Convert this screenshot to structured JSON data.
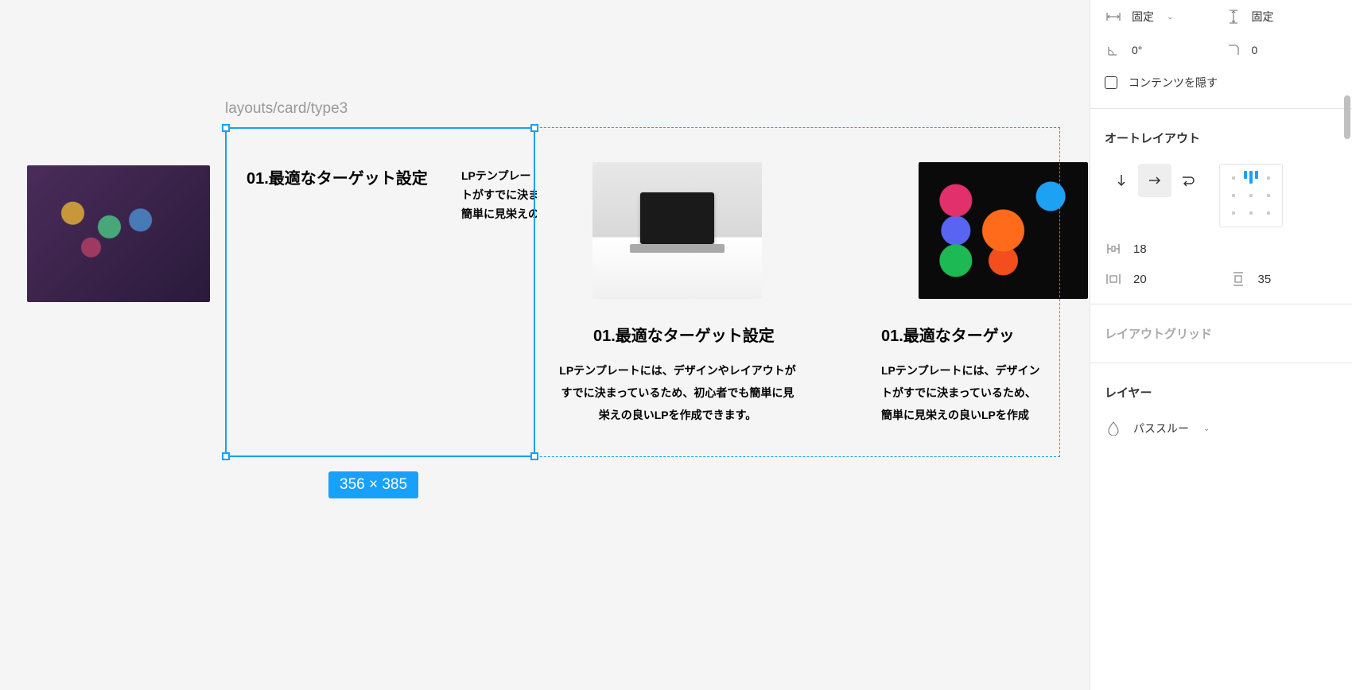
{
  "canvas": {
    "layer_label": "layouts/card/type3",
    "selection_size": "356 × 385",
    "cards": [
      {
        "title": "01.最適なターゲット設定",
        "desc_l1": "LPテンプレー",
        "desc_l2": "トがすでに決ま",
        "desc_l3": "簡単に見栄えの"
      },
      {
        "title": "01.最適なターゲット設定",
        "desc": "LPテンプレートには、デザインやレイアウトがすでに決まっているため、初心者でも簡単に見栄えの良いLPを作成できます。"
      },
      {
        "title": "01.最適なターゲッ",
        "desc_l1": "LPテンプレートには、デザイン",
        "desc_l2": "トがすでに決まっているため、",
        "desc_l3": "簡単に見栄えの良いLPを作成"
      }
    ]
  },
  "panel": {
    "resize": {
      "h_label": "固定",
      "v_label": "固定"
    },
    "rotation": "0°",
    "radius": "0",
    "clip_content": "コンテンツを隠す",
    "auto_layout": {
      "title": "オートレイアウト",
      "gap": "18",
      "padding_h": "20",
      "padding_v": "35"
    },
    "layout_grid": "レイアウトグリッド",
    "layer": {
      "title": "レイヤー",
      "blend": "パススルー"
    }
  }
}
